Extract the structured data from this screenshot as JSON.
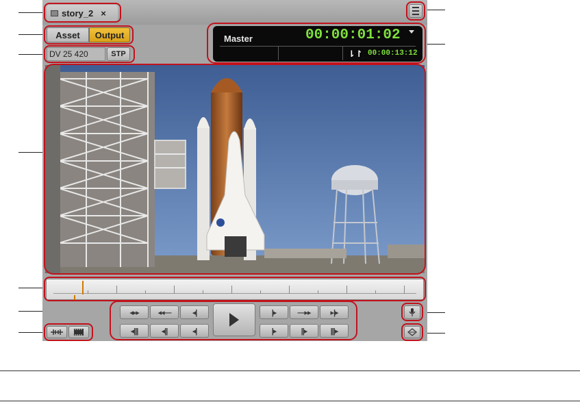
{
  "tab": {
    "title": "story_2",
    "close": "×",
    "icon": "monitor-icon"
  },
  "menu": {
    "icon": "hamburger-menu-icon"
  },
  "source_toggle": {
    "asset_label": "Asset",
    "output_label": "Output",
    "selected": "Output",
    "accent": "#e8b22a"
  },
  "format": {
    "value": "DV 25 420",
    "stp_label": "STP"
  },
  "timecode": {
    "label": "Master",
    "value": "00:00:01:02",
    "duration": "00:00:13:12",
    "duration_icon": "duration-arrows-icon",
    "menu_icon": "triangle-down-icon",
    "color": "#7ee03c"
  },
  "transport": {
    "top_row": [
      "trim-left-icon",
      "mark-in-icon",
      "go-to-in-icon",
      "go-to-out-icon",
      "mark-out-icon",
      "trim-right-icon"
    ],
    "bottom_row": [
      "rewind-fast-icon",
      "rewind-icon",
      "step-back-icon",
      "step-forward-icon",
      "forward-icon",
      "forward-fast-icon"
    ],
    "play_icon": "play-icon"
  },
  "left_tools": [
    "audio-scrub-icon",
    "filmstrip-icon"
  ],
  "right_tools": [
    "microphone-icon",
    "sync-lock-icon"
  ],
  "highlight_color": "#c2121c"
}
